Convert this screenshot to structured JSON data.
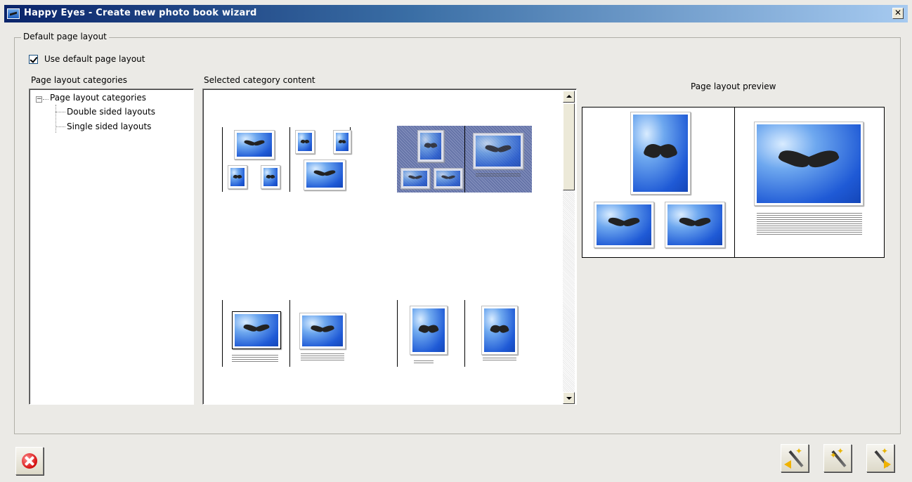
{
  "window": {
    "title": "Happy Eyes - Create new photo book wizard",
    "close_glyph": "✕"
  },
  "group": {
    "legend": "Default page layout"
  },
  "checkbox": {
    "label": "Use default page layout",
    "checked": true
  },
  "tree": {
    "header": "Page layout categories",
    "root": {
      "label": "Page layout categories",
      "expander": "−"
    },
    "children": [
      {
        "label": "Double sided layouts"
      },
      {
        "label": "Single sided layouts"
      }
    ]
  },
  "content": {
    "header": "Selected category content"
  },
  "preview": {
    "header": "Page layout preview"
  },
  "icons": {
    "cancel": "cancel-x-icon",
    "back": "wizard-back-icon",
    "magic": "wizard-wand-icon",
    "next": "wizard-next-icon"
  }
}
